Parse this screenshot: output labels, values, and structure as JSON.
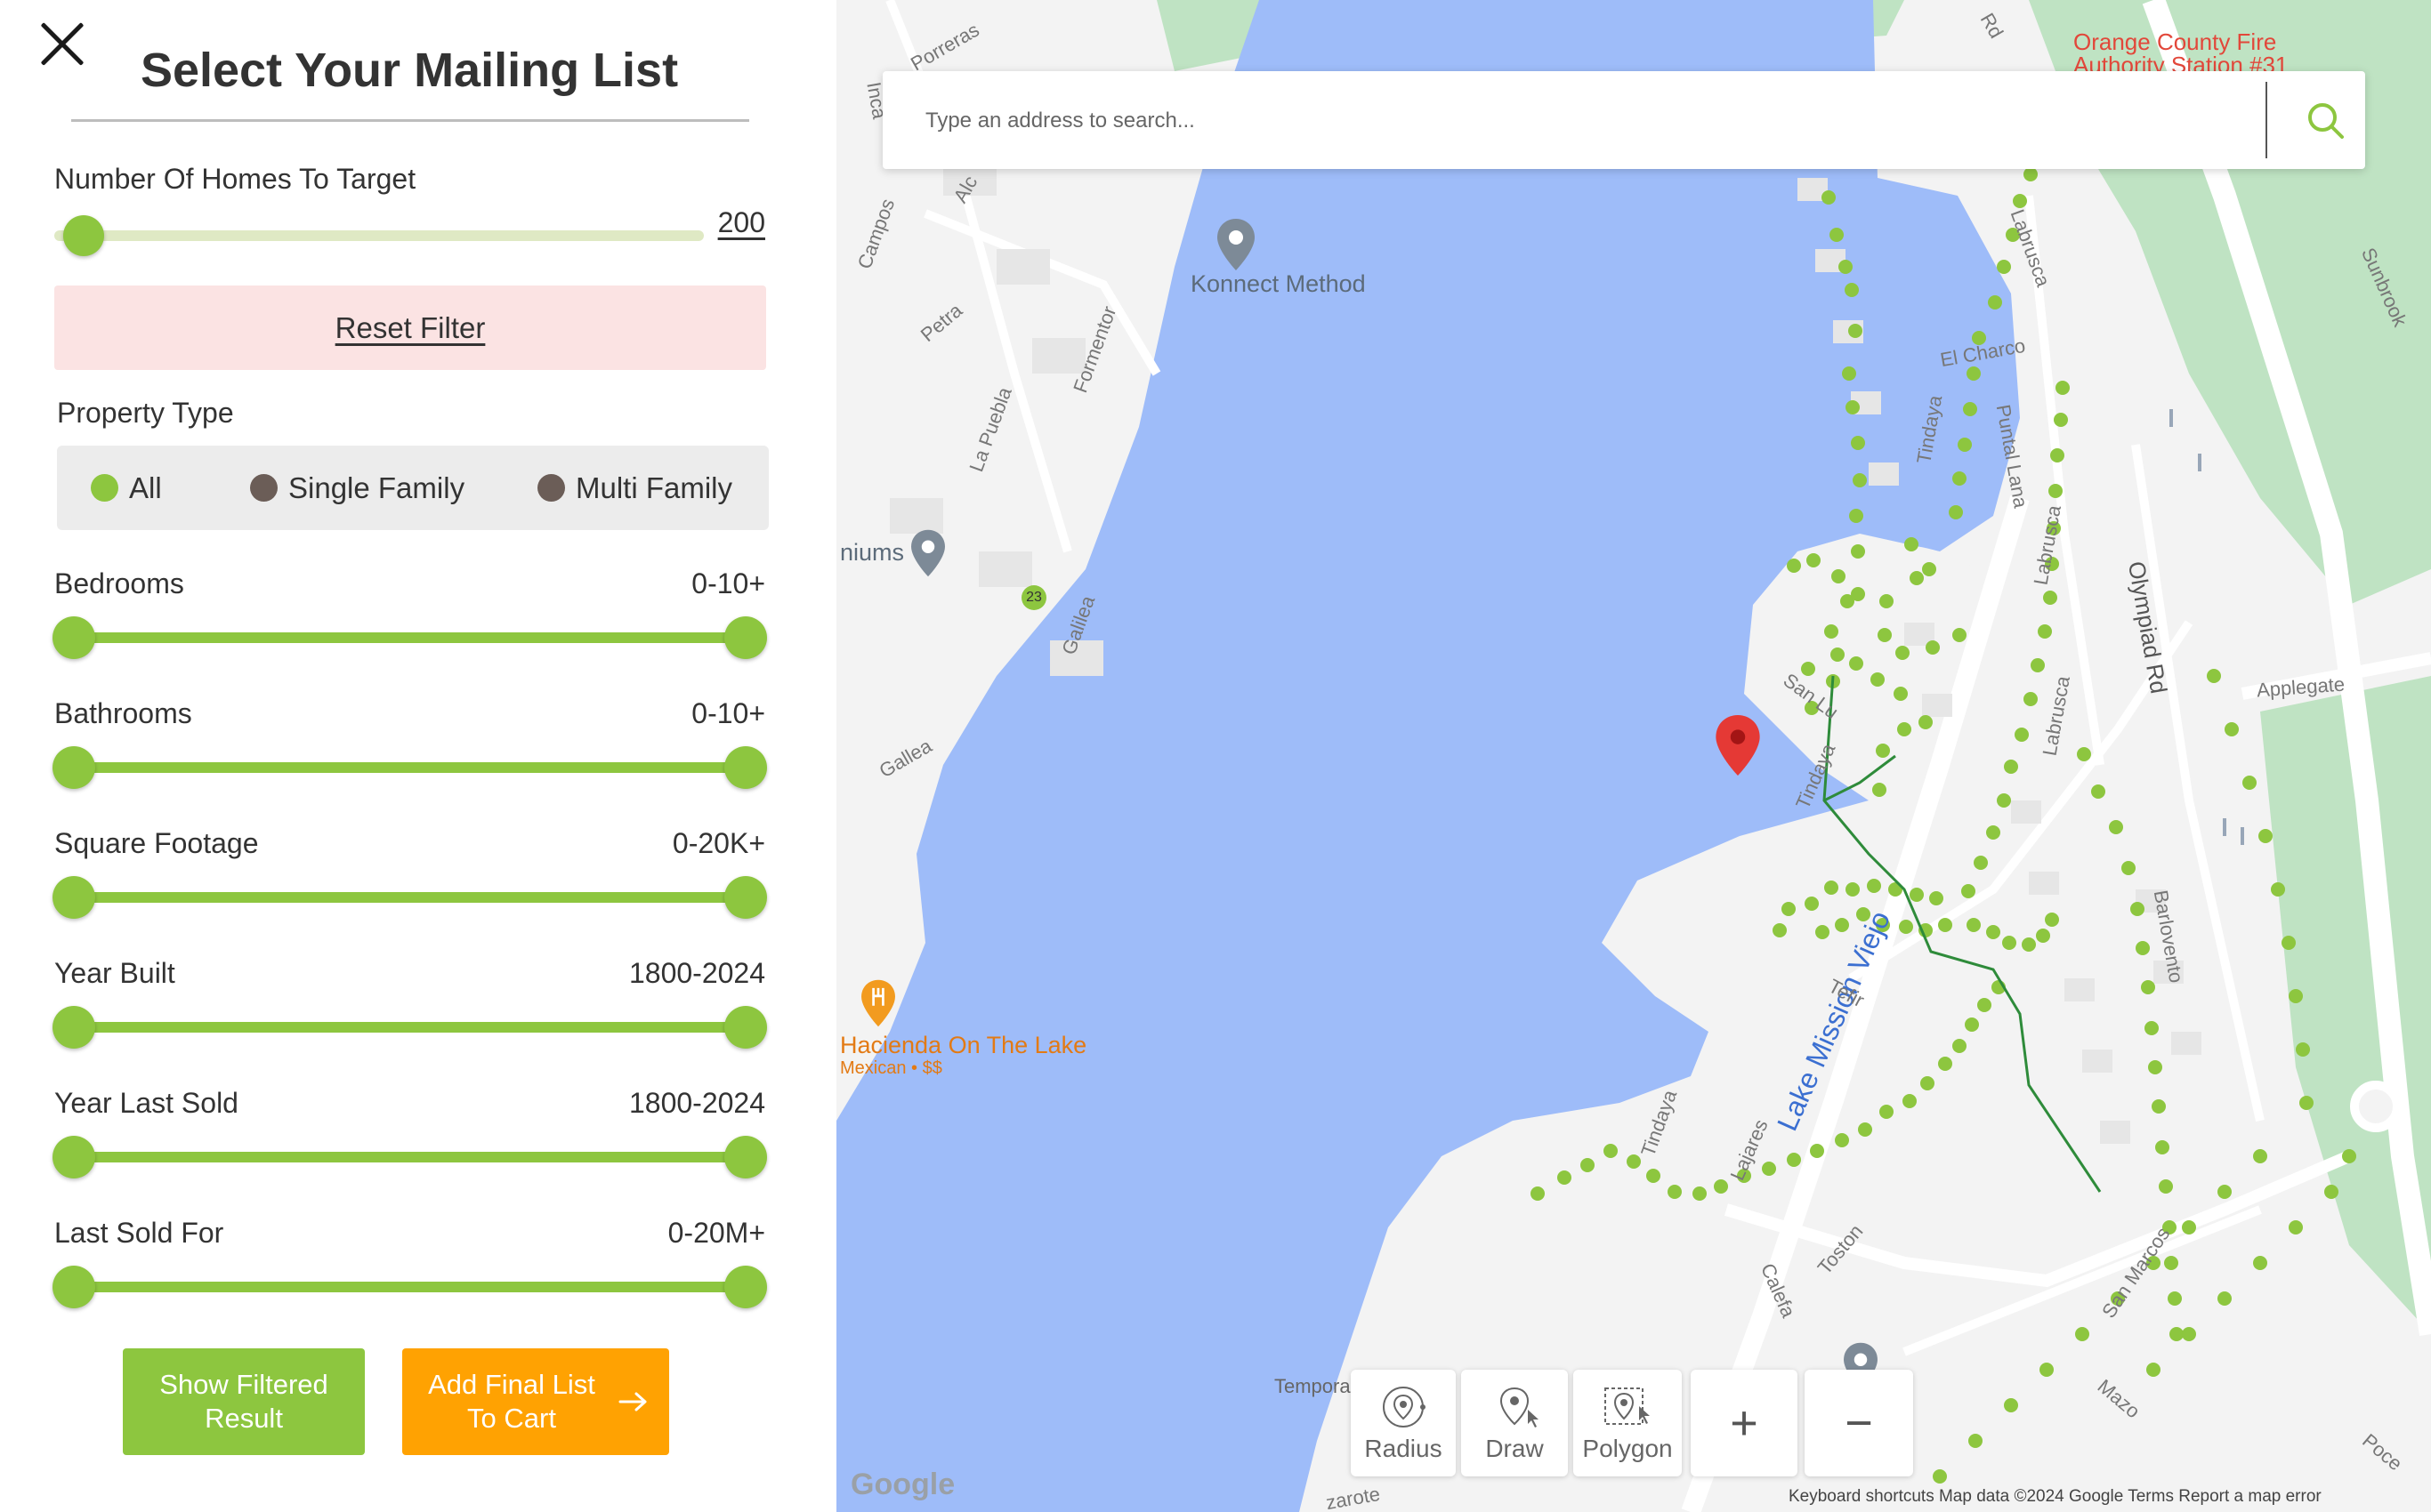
{
  "panel": {
    "title": "Select Your Mailing List",
    "homes": {
      "label": "Number Of Homes To Target",
      "value": "200",
      "level": 0.0
    },
    "reset_label": "Reset Filter",
    "property_type": {
      "label": "Property Type",
      "options": [
        {
          "label": "All",
          "selected": true
        },
        {
          "label": "Single Family",
          "selected": false
        },
        {
          "label": "Multi Family",
          "selected": false
        }
      ]
    },
    "filters": [
      {
        "label": "Bedrooms",
        "value": "0-10+"
      },
      {
        "label": "Bathrooms",
        "value": "0-10+"
      },
      {
        "label": "Square Footage",
        "value": "0-20K+"
      },
      {
        "label": "Year Built",
        "value": "1800-2024"
      },
      {
        "label": "Year Last Sold",
        "value": "1800-2024"
      },
      {
        "label": "Last Sold For",
        "value": "0-20M+"
      }
    ],
    "show_filtered_label": "Show Filtered Result",
    "add_to_cart_label": "Add Final List To Cart"
  },
  "map": {
    "search_placeholder": "Type an address to search...",
    "poi": {
      "konnect": "Konnect Method",
      "hacienda": "Hacienda On The Lake",
      "hacienda_sub": "Mexican • $$",
      "fire": "Orange County Fire Authority Station #31",
      "niums": "niums",
      "tempora": "Tempora",
      "lake": "Lake Mission Viejo"
    },
    "roads": [
      "Porreras",
      "Inca",
      "Alc",
      "Campos",
      "Petra",
      "Formentor",
      "La Puebla",
      "Galilea",
      "Gallea",
      "Labrusca",
      "El Charco",
      "Tindaya",
      "Puntal Lana",
      "Labrusca",
      "Olympiad Rd",
      "Applegate",
      "Sunbrook",
      "San Lu",
      "Tindaya",
      "Tefir",
      "Tindaya",
      "Lajares",
      "Toston",
      "Calefa",
      "Barlovento",
      "San Marcos",
      "Mazo",
      "Poce",
      "zarote",
      "Labrusca",
      "Rd"
    ],
    "route_badge": "23",
    "tools": {
      "radius": "Radius",
      "draw": "Draw",
      "polygon": "Polygon",
      "zoom_in": "+",
      "zoom_out": "−"
    },
    "logo": "Google",
    "attribution": "Keyboard shortcuts  Map data ©2024 Google  Terms  Report a map error"
  },
  "colors": {
    "accent_green": "#8dc63f",
    "cta_orange": "#ffa202",
    "reset_bg": "#fbe3e3",
    "water": "#9ebcf9",
    "marker_red": "#e53935"
  }
}
